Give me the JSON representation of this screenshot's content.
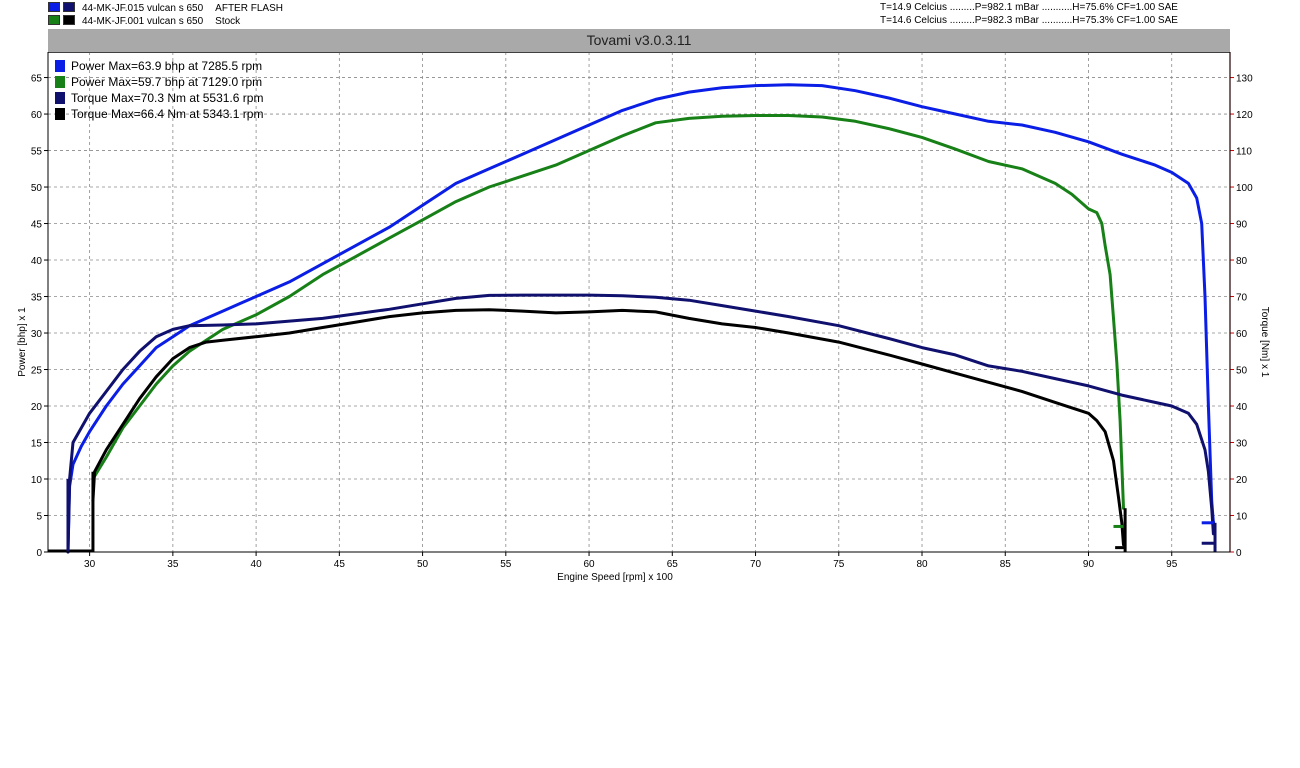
{
  "runs": [
    {
      "id": "44-MK-JF.015 vulcan s 650",
      "note": "AFTER FLASH",
      "power_color": "#0a1ee6",
      "torque_color": "#10106e",
      "env": "T=14.9 Celcius .........P=982.1 mBar ...........H=75.6% CF=1.00 SAE"
    },
    {
      "id": "44-MK-JF.001 vulcan s 650",
      "note": "Stock",
      "power_color": "#178017",
      "torque_color": "#000000",
      "env": "T=14.6 Celcius .........P=982.3 mBar ...........H=75.3% CF=1.00 SAE"
    }
  ],
  "app_title": "Tovami  v3.0.3.11",
  "chart_data": {
    "type": "line",
    "xlabel": "Engine Speed [rpm] x 100",
    "ylabel_left": "Power [bhp] x 1",
    "ylabel_right": "Torque [Nm] x 1",
    "xlim": [
      27.5,
      98.5
    ],
    "ylim_left": [
      0,
      68.5
    ],
    "ylim_right": [
      0,
      137
    ],
    "x_ticks": [
      30,
      35,
      40,
      45,
      50,
      55,
      60,
      65,
      70,
      75,
      80,
      85,
      90,
      95
    ],
    "y_ticks_left": [
      0,
      5,
      10,
      15,
      20,
      25,
      30,
      35,
      40,
      45,
      50,
      55,
      60,
      65
    ],
    "y_ticks_right": [
      0,
      10,
      20,
      30,
      40,
      50,
      60,
      70,
      80,
      90,
      100,
      110,
      120,
      130
    ],
    "grid": true,
    "legend": [
      {
        "label": "Power  Max=63.9 bhp at 7285.5 rpm",
        "color": "#0a1ee6"
      },
      {
        "label": "Power  Max=59.7 bhp at 7129.0 rpm",
        "color": "#178017"
      },
      {
        "label": "Torque  Max=70.3 Nm at 5531.6 rpm",
        "color": "#10106e"
      },
      {
        "label": "Torque  Max=66.4 Nm at 5343.1 rpm",
        "color": "#000000"
      }
    ],
    "series": [
      {
        "axis": "left",
        "color": "#0a1ee6",
        "points": [
          [
            28.7,
            0
          ],
          [
            28.8,
            9
          ],
          [
            29,
            12
          ],
          [
            29.5,
            14.5
          ],
          [
            30,
            16.5
          ],
          [
            31,
            20
          ],
          [
            32,
            23
          ],
          [
            33,
            25.5
          ],
          [
            34,
            28
          ],
          [
            35,
            29.5
          ],
          [
            36,
            31
          ],
          [
            37,
            32
          ],
          [
            38,
            33
          ],
          [
            39,
            34
          ],
          [
            40,
            35
          ],
          [
            42,
            37
          ],
          [
            44,
            39.5
          ],
          [
            46,
            42
          ],
          [
            48,
            44.5
          ],
          [
            50,
            47.5
          ],
          [
            52,
            50.5
          ],
          [
            54,
            52.5
          ],
          [
            56,
            54.5
          ],
          [
            58,
            56.5
          ],
          [
            60,
            58.5
          ],
          [
            62,
            60.5
          ],
          [
            64,
            62
          ],
          [
            66,
            63
          ],
          [
            68,
            63.6
          ],
          [
            70,
            63.9
          ],
          [
            72,
            64
          ],
          [
            74,
            63.9
          ],
          [
            76,
            63.2
          ],
          [
            78,
            62.2
          ],
          [
            80,
            61
          ],
          [
            82,
            60
          ],
          [
            84,
            59
          ],
          [
            86,
            58.5
          ],
          [
            88,
            57.5
          ],
          [
            90,
            56.2
          ],
          [
            92,
            54.5
          ],
          [
            94,
            53
          ],
          [
            95,
            52
          ],
          [
            96,
            50.5
          ],
          [
            96.5,
            48.5
          ],
          [
            96.8,
            45
          ],
          [
            97,
            35
          ],
          [
            97.2,
            20
          ],
          [
            97.4,
            7
          ],
          [
            97.5,
            4
          ]
        ]
      },
      {
        "axis": "left",
        "color": "#178017",
        "points": [
          [
            30.2,
            10
          ],
          [
            31,
            13
          ],
          [
            32,
            17
          ],
          [
            33,
            20
          ],
          [
            34,
            23
          ],
          [
            35,
            25.5
          ],
          [
            36,
            27.5
          ],
          [
            37,
            29
          ],
          [
            38,
            30.5
          ],
          [
            40,
            32.5
          ],
          [
            42,
            35
          ],
          [
            44,
            38
          ],
          [
            46,
            40.5
          ],
          [
            48,
            43
          ],
          [
            50,
            45.5
          ],
          [
            52,
            48
          ],
          [
            54,
            50
          ],
          [
            56,
            51.5
          ],
          [
            58,
            53
          ],
          [
            60,
            55
          ],
          [
            62,
            57
          ],
          [
            64,
            58.8
          ],
          [
            66,
            59.4
          ],
          [
            68,
            59.7
          ],
          [
            70,
            59.8
          ],
          [
            72,
            59.8
          ],
          [
            74,
            59.6
          ],
          [
            76,
            59
          ],
          [
            78,
            58
          ],
          [
            80,
            56.8
          ],
          [
            82,
            55.2
          ],
          [
            84,
            53.5
          ],
          [
            86,
            52.5
          ],
          [
            88,
            50.5
          ],
          [
            89,
            49
          ],
          [
            90,
            47
          ],
          [
            90.5,
            46.5
          ],
          [
            90.8,
            45
          ],
          [
            91,
            42
          ],
          [
            91.3,
            38
          ],
          [
            91.5,
            32
          ],
          [
            91.7,
            26
          ],
          [
            91.9,
            18
          ],
          [
            92,
            12
          ],
          [
            92.1,
            6
          ]
        ]
      },
      {
        "axis": "right",
        "color": "#10106e",
        "points": [
          [
            28.7,
            0
          ],
          [
            28.8,
            20
          ],
          [
            29,
            30
          ],
          [
            29.5,
            34
          ],
          [
            30,
            38
          ],
          [
            31,
            44
          ],
          [
            32,
            50
          ],
          [
            33,
            55
          ],
          [
            34,
            59
          ],
          [
            35,
            61
          ],
          [
            36,
            62
          ],
          [
            38,
            62.2
          ],
          [
            40,
            62.5
          ],
          [
            44,
            64
          ],
          [
            48,
            66.5
          ],
          [
            50,
            68
          ],
          [
            52,
            69.5
          ],
          [
            54,
            70.3
          ],
          [
            56,
            70.4
          ],
          [
            60,
            70.4
          ],
          [
            62,
            70.2
          ],
          [
            64,
            69.8
          ],
          [
            66,
            69
          ],
          [
            68,
            67.5
          ],
          [
            70,
            66
          ],
          [
            72,
            64.5
          ],
          [
            75,
            62
          ],
          [
            78,
            58.5
          ],
          [
            80,
            56
          ],
          [
            82,
            54
          ],
          [
            84,
            51
          ],
          [
            86,
            49.5
          ],
          [
            88,
            47.5
          ],
          [
            90,
            45.5
          ],
          [
            92,
            43
          ],
          [
            94,
            41
          ],
          [
            95,
            40
          ],
          [
            96,
            38
          ],
          [
            96.5,
            35
          ],
          [
            97,
            28
          ],
          [
            97.2,
            22
          ],
          [
            97.4,
            12
          ],
          [
            97.5,
            5
          ]
        ]
      },
      {
        "axis": "right",
        "color": "#000000",
        "points": [
          [
            30.2,
            14
          ],
          [
            30.3,
            22
          ],
          [
            31,
            28
          ],
          [
            32,
            35
          ],
          [
            33,
            42
          ],
          [
            34,
            48
          ],
          [
            35,
            53
          ],
          [
            36,
            56
          ],
          [
            37,
            57.5
          ],
          [
            38,
            58
          ],
          [
            40,
            59
          ],
          [
            42,
            60
          ],
          [
            44,
            61.5
          ],
          [
            46,
            63
          ],
          [
            48,
            64.5
          ],
          [
            50,
            65.5
          ],
          [
            52,
            66.2
          ],
          [
            54,
            66.4
          ],
          [
            56,
            66
          ],
          [
            58,
            65.5
          ],
          [
            60,
            65.8
          ],
          [
            62,
            66.2
          ],
          [
            64,
            65.8
          ],
          [
            66,
            64
          ],
          [
            68,
            62.5
          ],
          [
            70,
            61.5
          ],
          [
            72,
            60
          ],
          [
            75,
            57.5
          ],
          [
            78,
            54
          ],
          [
            80,
            51.5
          ],
          [
            82,
            49
          ],
          [
            84,
            46.5
          ],
          [
            86,
            44
          ],
          [
            88,
            41
          ],
          [
            90,
            38
          ],
          [
            90.5,
            36
          ],
          [
            91,
            33
          ],
          [
            91.5,
            25
          ],
          [
            91.8,
            15
          ],
          [
            92,
            8
          ],
          [
            92.1,
            2
          ]
        ]
      }
    ],
    "end_markers": [
      {
        "color": "#178017",
        "y_left": 3.5,
        "x_from": 91.5,
        "x_to": 92.2
      },
      {
        "color": "#000000",
        "y_left": 0.6,
        "x_from": 91.6,
        "x_to": 92.2
      },
      {
        "color": "#0a1ee6",
        "y_left": 4,
        "x_from": 96.8,
        "x_to": 97.6
      },
      {
        "color": "#10106e",
        "y_left": 1.2,
        "x_from": 96.8,
        "x_to": 97.6
      }
    ]
  }
}
